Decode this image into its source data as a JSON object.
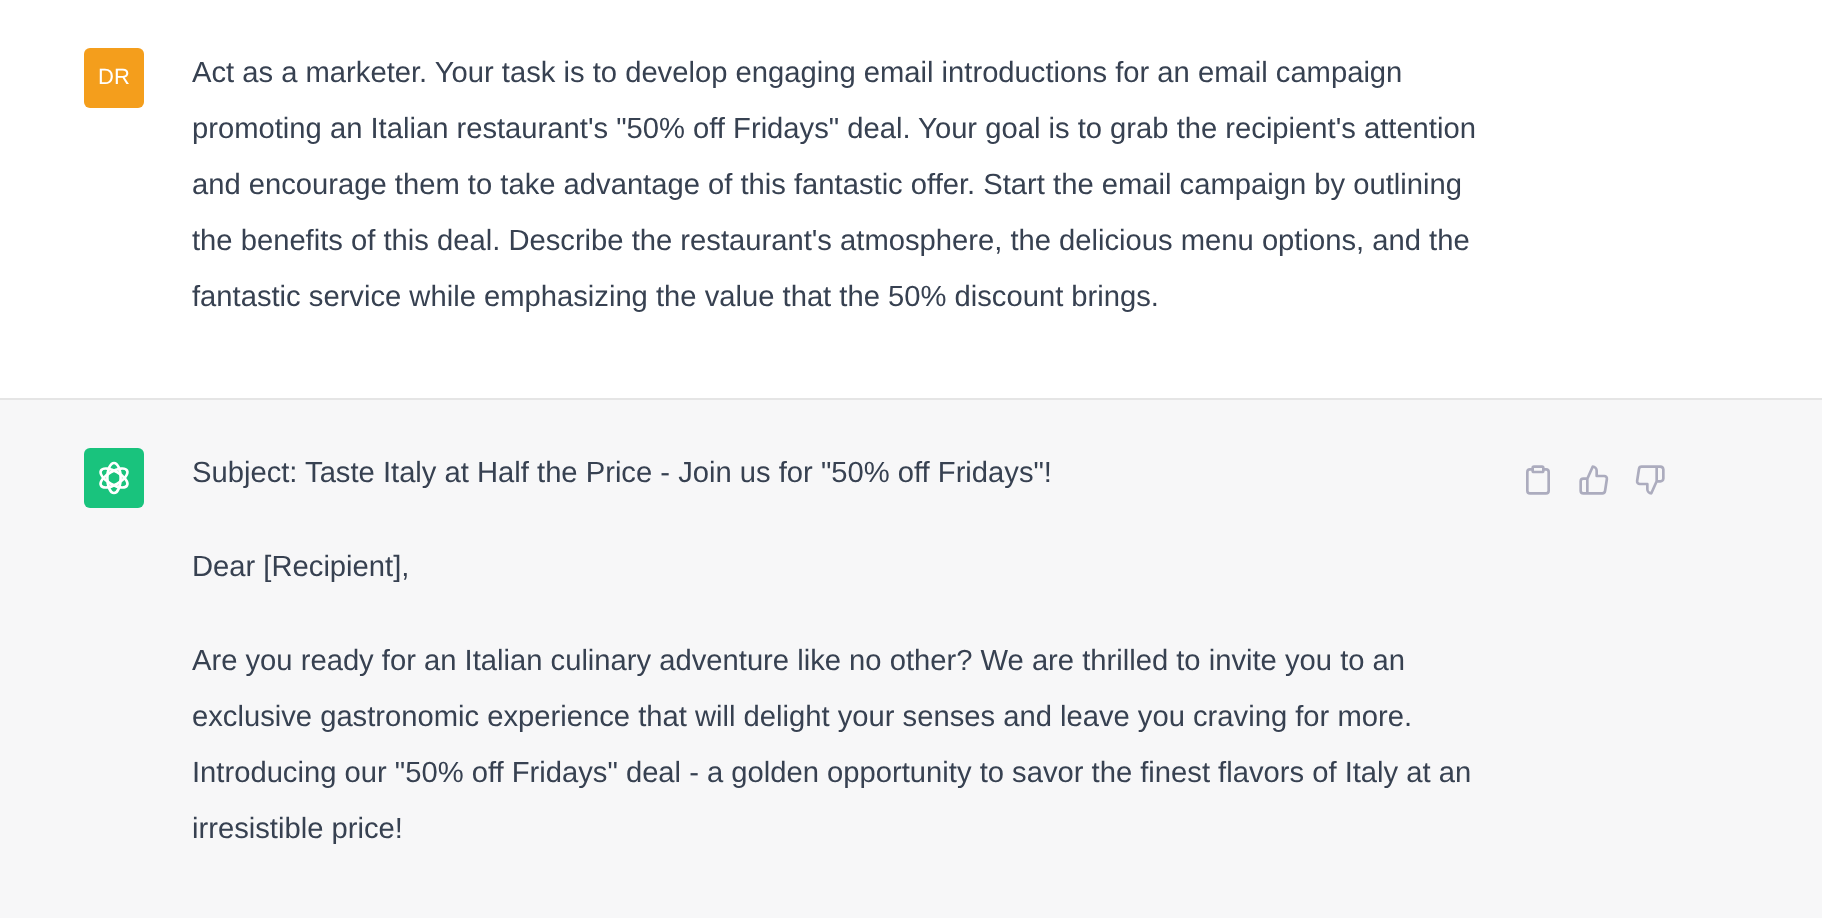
{
  "messages": [
    {
      "kind": "user",
      "avatar": "DR",
      "paragraphs": [
        "Act as a marketer. Your task is to develop engaging email introductions for an email campaign promoting an Italian restaurant's \"50% off Fridays\" deal. Your goal is to grab the recipient's attention and encourage them to take advantage of this fantastic offer. Start the email campaign by outlining the benefits of this deal. Describe the restaurant's atmosphere, the delicious menu options, and the fantastic service while emphasizing the value that the 50% discount brings."
      ]
    },
    {
      "kind": "assistant",
      "paragraphs": [
        "Subject: Taste Italy at Half the Price - Join us for \"50% off Fridays\"!",
        "Dear [Recipient],",
        "Are you ready for an Italian culinary adventure like no other? We are thrilled to invite you to an exclusive gastronomic experience that will delight your senses and leave you craving for more. Introducing our \"50% off Fridays\" deal - a golden opportunity to savor the finest flavors of Italy at an irresistible price!"
      ]
    }
  ]
}
